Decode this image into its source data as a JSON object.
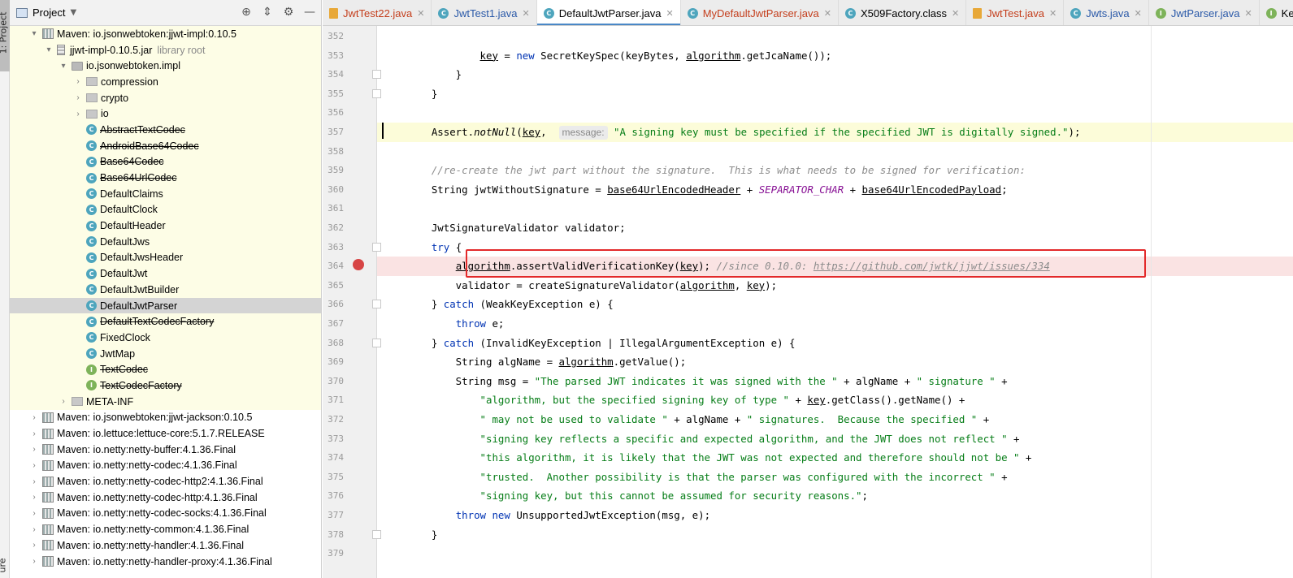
{
  "toolstrip": {
    "project_tab": "1: Project",
    "structure_tab": "ure"
  },
  "project_panel": {
    "title": "Project",
    "tree": [
      {
        "indent": 0,
        "arrow": "▾",
        "icon": "lib",
        "label": "Maven: io.jsonwebtoken:jjwt-impl:0.10.5",
        "hl": true
      },
      {
        "indent": 1,
        "arrow": "▾",
        "icon": "jar",
        "label": "jjwt-impl-0.10.5.jar",
        "sub": "library root",
        "hl": true
      },
      {
        "indent": 2,
        "arrow": "▾",
        "icon": "pkg",
        "label": "io.jsonwebtoken.impl",
        "hl": true
      },
      {
        "indent": 3,
        "arrow": "›",
        "icon": "folder",
        "label": "compression",
        "hl": true
      },
      {
        "indent": 3,
        "arrow": "›",
        "icon": "folder",
        "label": "crypto",
        "hl": true
      },
      {
        "indent": 3,
        "arrow": "›",
        "icon": "folder",
        "label": "io",
        "hl": true
      },
      {
        "indent": 3,
        "arrow": "",
        "icon": "cls",
        "label": "AbstractTextCodec",
        "strike": true,
        "hl": true
      },
      {
        "indent": 3,
        "arrow": "",
        "icon": "cls",
        "label": "AndroidBase64Codec",
        "strike": true,
        "hl": true
      },
      {
        "indent": 3,
        "arrow": "",
        "icon": "cls",
        "label": "Base64Codec",
        "strike": true,
        "hl": true
      },
      {
        "indent": 3,
        "arrow": "",
        "icon": "cls",
        "label": "Base64UrlCodec",
        "strike": true,
        "hl": true
      },
      {
        "indent": 3,
        "arrow": "",
        "icon": "cls",
        "label": "DefaultClaims",
        "hl": true
      },
      {
        "indent": 3,
        "arrow": "",
        "icon": "cls",
        "label": "DefaultClock",
        "hl": true
      },
      {
        "indent": 3,
        "arrow": "",
        "icon": "cls",
        "label": "DefaultHeader",
        "hl": true
      },
      {
        "indent": 3,
        "arrow": "",
        "icon": "cls",
        "label": "DefaultJws",
        "hl": true
      },
      {
        "indent": 3,
        "arrow": "",
        "icon": "cls",
        "label": "DefaultJwsHeader",
        "hl": true
      },
      {
        "indent": 3,
        "arrow": "",
        "icon": "cls",
        "label": "DefaultJwt",
        "hl": true
      },
      {
        "indent": 3,
        "arrow": "",
        "icon": "cls",
        "label": "DefaultJwtBuilder",
        "hl": true
      },
      {
        "indent": 3,
        "arrow": "",
        "icon": "cls",
        "label": "DefaultJwtParser",
        "sel": true
      },
      {
        "indent": 3,
        "arrow": "",
        "icon": "cls",
        "label": "DefaultTextCodecFactory",
        "strike": true,
        "hl": true
      },
      {
        "indent": 3,
        "arrow": "",
        "icon": "cls",
        "label": "FixedClock",
        "hl": true
      },
      {
        "indent": 3,
        "arrow": "",
        "icon": "cls",
        "label": "JwtMap",
        "hl": true
      },
      {
        "indent": 3,
        "arrow": "",
        "icon": "itf",
        "label": "TextCodec",
        "strike": true,
        "hl": true
      },
      {
        "indent": 3,
        "arrow": "",
        "icon": "itf",
        "label": "TextCodecFactory",
        "strike": true,
        "hl": true
      },
      {
        "indent": 2,
        "arrow": "›",
        "icon": "folder",
        "label": "META-INF",
        "hl": true
      },
      {
        "indent": 0,
        "arrow": "›",
        "icon": "lib",
        "label": "Maven: io.jsonwebtoken:jjwt-jackson:0.10.5"
      },
      {
        "indent": 0,
        "arrow": "›",
        "icon": "lib",
        "label": "Maven: io.lettuce:lettuce-core:5.1.7.RELEASE"
      },
      {
        "indent": 0,
        "arrow": "›",
        "icon": "lib",
        "label": "Maven: io.netty:netty-buffer:4.1.36.Final"
      },
      {
        "indent": 0,
        "arrow": "›",
        "icon": "lib",
        "label": "Maven: io.netty:netty-codec:4.1.36.Final"
      },
      {
        "indent": 0,
        "arrow": "›",
        "icon": "lib",
        "label": "Maven: io.netty:netty-codec-http2:4.1.36.Final"
      },
      {
        "indent": 0,
        "arrow": "›",
        "icon": "lib",
        "label": "Maven: io.netty:netty-codec-http:4.1.36.Final"
      },
      {
        "indent": 0,
        "arrow": "›",
        "icon": "lib",
        "label": "Maven: io.netty:netty-codec-socks:4.1.36.Final"
      },
      {
        "indent": 0,
        "arrow": "›",
        "icon": "lib",
        "label": "Maven: io.netty:netty-common:4.1.36.Final"
      },
      {
        "indent": 0,
        "arrow": "›",
        "icon": "lib",
        "label": "Maven: io.netty:netty-handler:4.1.36.Final"
      },
      {
        "indent": 0,
        "arrow": "›",
        "icon": "lib",
        "label": "Maven: io.netty:netty-handler-proxy:4.1.36.Final"
      }
    ]
  },
  "tabs": [
    {
      "label": "JwtTest22.java",
      "icon": "j",
      "style": "err"
    },
    {
      "label": "JwtTest1.java",
      "icon": "c",
      "style": "mod"
    },
    {
      "label": "DefaultJwtParser.java",
      "icon": "c",
      "style": "",
      "active": true
    },
    {
      "label": "MyDefaultJwtParser.java",
      "icon": "c",
      "style": "err"
    },
    {
      "label": "X509Factory.class",
      "icon": "c",
      "style": ""
    },
    {
      "label": "JwtTest.java",
      "icon": "j",
      "style": "err"
    },
    {
      "label": "Jwts.java",
      "icon": "c",
      "style": "mod"
    },
    {
      "label": "JwtParser.java",
      "icon": "i",
      "style": "mod"
    },
    {
      "label": "Key.java",
      "icon": "i",
      "style": ""
    }
  ],
  "editor": {
    "line_numbers": [
      "352",
      "353",
      "354",
      "355",
      "356",
      "357",
      "358",
      "359",
      "360",
      "361",
      "362",
      "363",
      "364",
      "365",
      "366",
      "367",
      "368",
      "369",
      "370",
      "371",
      "372",
      "373",
      "374",
      "375",
      "376",
      "377",
      "378",
      "379"
    ],
    "hint_message": "message:",
    "comment_since": "//since 0.10.0: ",
    "issue_url": "https://github.com/jwtk/jjwt/issues/334",
    "assert_message": "\"A signing key must be specified if the specified JWT is digitally signed.\"",
    "recreate_comment": "//re-create the jwt part without the signature.  This is what needs to be signed for verification:",
    "msg_strings": [
      "\"The parsed JWT indicates it was signed with the \"",
      "\" signature \"",
      "\"algorithm, but the specified signing key of type \"",
      "\" may not be used to validate \"",
      "\" signatures.  Because the specified \"",
      "\"signing key reflects a specific and expected algorithm, and the JWT does not reflect \"",
      "\"this algorithm, it is likely that the JWT was not expected and therefore should not be \"",
      "\"trusted.  Another possibility is that the parser was configured with the incorrect \"",
      "\"signing key, but this cannot be assumed for security reasons.\""
    ]
  }
}
